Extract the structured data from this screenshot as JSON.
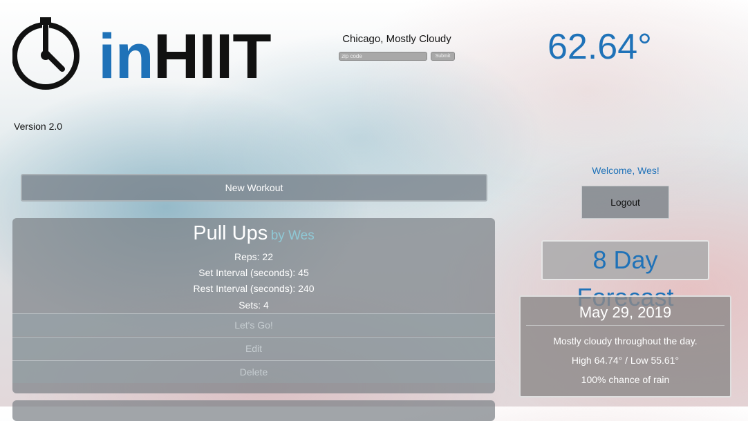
{
  "header": {
    "logo": {
      "prefix": "in",
      "suffix": "HIIT",
      "icon": "stopwatch-icon"
    },
    "version": "Version 2.0"
  },
  "weather": {
    "location": "Chicago, Mostly Cloudy",
    "zip_placeholder": "zip code",
    "submit_label": "Submit",
    "temperature": "62.64°"
  },
  "workouts": {
    "new_workout_label": "New Workout",
    "items": [
      {
        "name": "Pull Ups",
        "author": "by Wes",
        "reps": "Reps: 22",
        "set_interval": "Set Interval (seconds): 45",
        "rest_interval": "Rest Interval (seconds): 240",
        "sets": "Sets: 4",
        "lets_go_label": "Let's Go!",
        "edit_label": "Edit",
        "delete_label": "Delete"
      }
    ]
  },
  "user": {
    "welcome": "Welcome, Wes!",
    "logout_label": "Logout"
  },
  "forecast": {
    "heading": "8 Day Forecast",
    "days": [
      {
        "date": "May 29, 2019",
        "summary": "Mostly cloudy throughout the day.",
        "high_low": "High 64.74° / Low 55.61°",
        "rain": "100% chance of rain"
      }
    ]
  },
  "colors": {
    "brand_blue": "#1f72b8",
    "card_gray": "#7d8288",
    "author_teal": "#8fc9d6"
  }
}
